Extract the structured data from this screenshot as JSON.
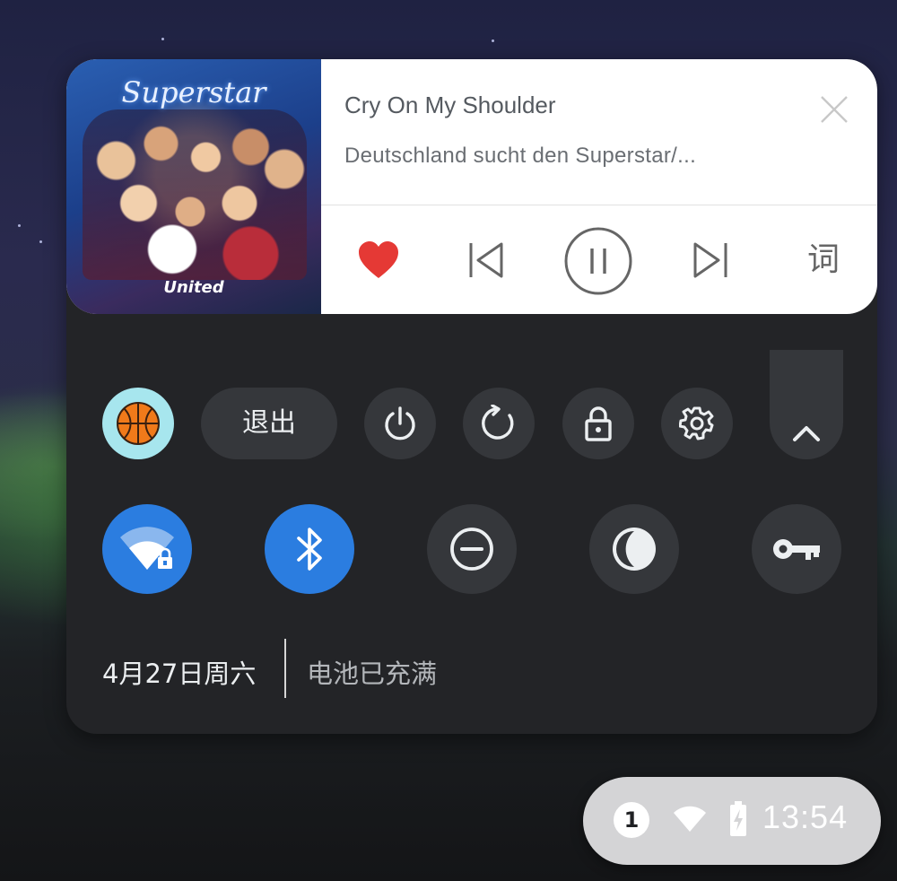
{
  "media": {
    "title": "Cry On My Shoulder",
    "artist": "Deutschland sucht den Superstar/...",
    "album_logo": "Superstar",
    "album_subtitle": "United",
    "lyrics_label": "词",
    "icons": {
      "close": "close-icon",
      "like": "heart-icon",
      "previous": "skip-previous-icon",
      "pause": "pause-icon",
      "next": "skip-next-icon"
    },
    "colors": {
      "heart": "#e53935"
    }
  },
  "quick_row": {
    "avatar_icon": "basketball-icon",
    "signout_label": "退出",
    "power_icon": "power-icon",
    "restart_icon": "restart-icon",
    "lock_icon": "lock-icon",
    "settings_icon": "gear-icon",
    "collapse_icon": "chevron-up-icon"
  },
  "toggles": [
    {
      "name": "wifi",
      "icon": "wifi-lock-icon",
      "on": true
    },
    {
      "name": "bluetooth",
      "icon": "bluetooth-icon",
      "on": true
    },
    {
      "name": "do-not-disturb",
      "icon": "do-not-disturb-icon",
      "on": false
    },
    {
      "name": "night-light",
      "icon": "night-light-icon",
      "on": false
    },
    {
      "name": "vpn",
      "icon": "key-icon",
      "on": false
    }
  ],
  "status": {
    "date": "4月27日周六",
    "battery": "电池已充满"
  },
  "tray": {
    "notification_count": "1",
    "time": "13:54"
  },
  "theme": {
    "accent": "#2b7de0",
    "panel_bg": "#232427",
    "button_bg": "#35373b"
  }
}
